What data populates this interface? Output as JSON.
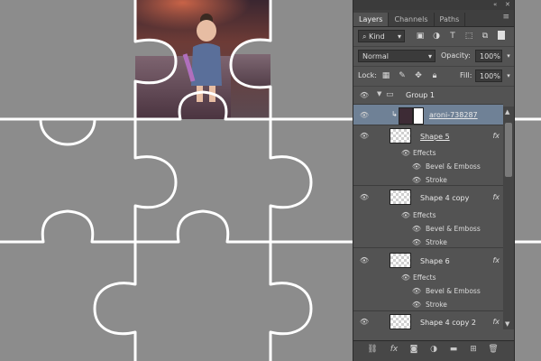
{
  "panel": {
    "tabs": [
      {
        "label": "Layers",
        "active": true
      },
      {
        "label": "Channels",
        "active": false
      },
      {
        "label": "Paths",
        "active": false
      }
    ],
    "filter": {
      "value": "Kind"
    },
    "blend_mode": {
      "value": "Normal"
    },
    "opacity": {
      "label": "Opacity:",
      "value": "100%"
    },
    "lock": {
      "label": "Lock:"
    },
    "fill": {
      "label": "Fill:",
      "value": "100%"
    },
    "layers": {
      "group": {
        "name": "Group 1"
      },
      "photo": {
        "name": "aroni-738287"
      },
      "shape5": {
        "name": "Shape 5",
        "effects": "Effects",
        "bevel": "Bevel & Emboss",
        "stroke": "Stroke",
        "fx": "fx"
      },
      "shape4copy": {
        "name": "Shape 4 copy",
        "effects": "Effects",
        "bevel": "Bevel & Emboss",
        "stroke": "Stroke",
        "fx": "fx"
      },
      "shape6": {
        "name": "Shape 6",
        "effects": "Effects",
        "bevel": "Bevel & Emboss",
        "stroke": "Stroke",
        "fx": "fx"
      },
      "shape4copy2": {
        "name": "Shape 4 copy 2",
        "fx": "fx"
      }
    },
    "footer_icons": [
      "link-icon",
      "fx-icon",
      "mask-icon",
      "adjustment-icon",
      "folder-icon",
      "new-layer-icon",
      "trash-icon"
    ]
  },
  "colors": {
    "canvas": "#8c8c8c",
    "puzzle_piece": "#9a9a9a",
    "selected_layer": "#6f8196",
    "panel_bg": "#535353"
  }
}
